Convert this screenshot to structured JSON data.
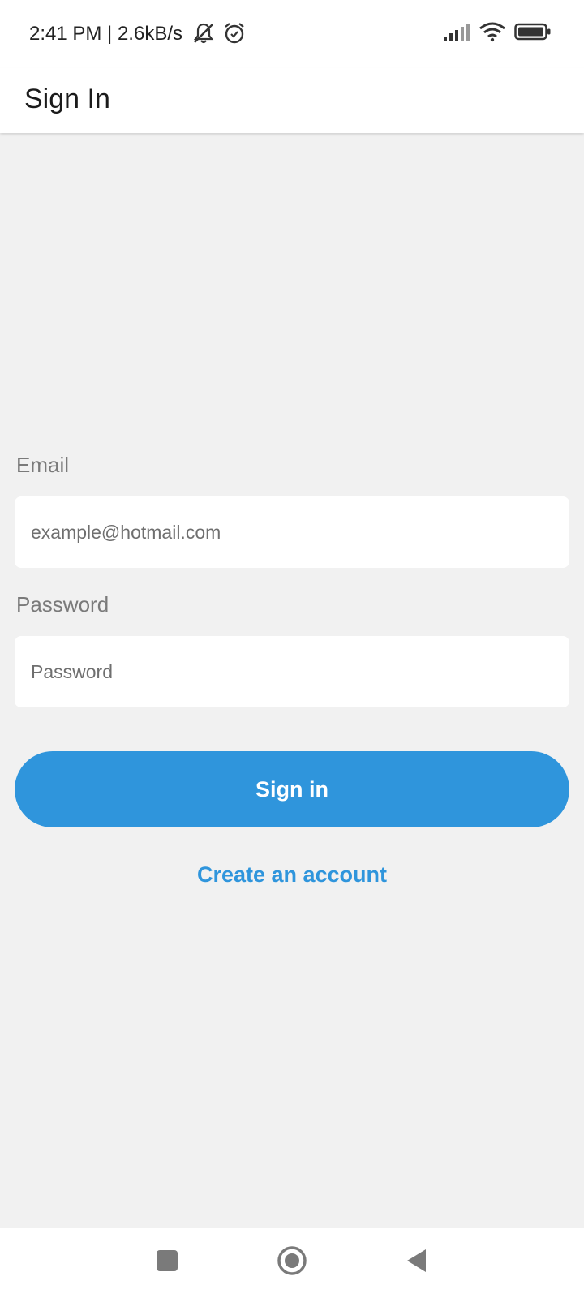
{
  "status_bar": {
    "time": "2:41 PM | 2.6kB/s",
    "icons_left": [
      "bell-off-icon",
      "alarm-icon"
    ],
    "icons_right": [
      "signal-icon",
      "wifi-icon",
      "battery-icon"
    ]
  },
  "app_bar": {
    "title": "Sign In"
  },
  "form": {
    "email_label": "Email",
    "email_placeholder": "example@hotmail.com",
    "email_value": "",
    "password_label": "Password",
    "password_placeholder": "Password",
    "password_value": "",
    "sign_in_label": "Sign in",
    "create_account_label": "Create an account"
  },
  "nav_bar": {
    "buttons": [
      "recents-icon",
      "home-icon",
      "back-icon"
    ]
  },
  "colors": {
    "accent": "#2f95dc",
    "background": "#f1f1f1",
    "surface": "#ffffff",
    "label": "#7a7a7a"
  }
}
